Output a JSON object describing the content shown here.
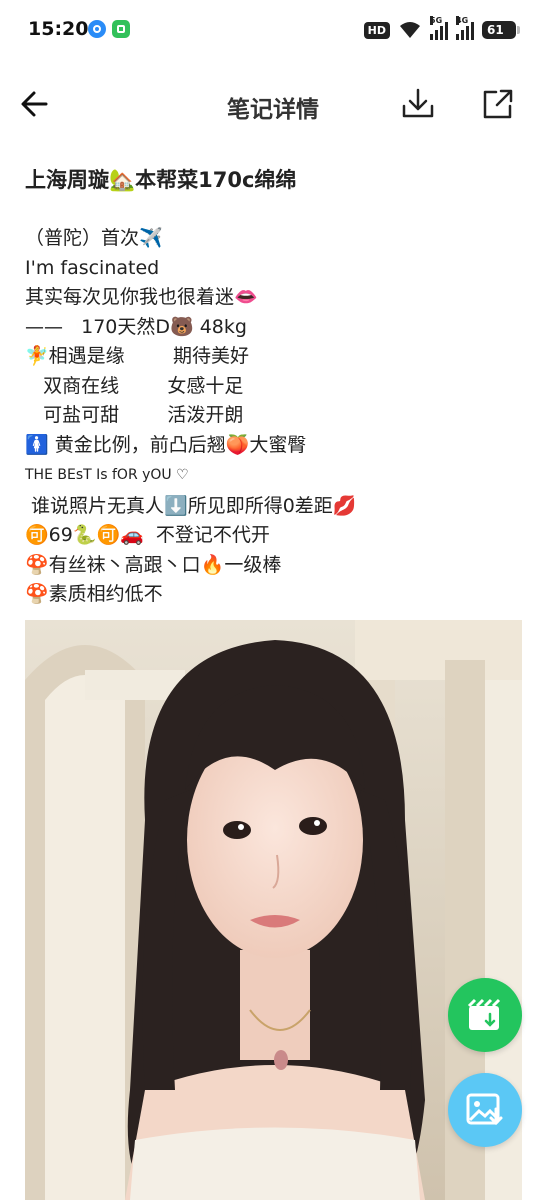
{
  "status_bar": {
    "time": "15:20",
    "hd_label": "HD",
    "net1": "5G",
    "net2": "4G",
    "battery": "61"
  },
  "header": {
    "title": "笔记详情"
  },
  "note": {
    "title": "上海周璇🏡本帮菜170c绵绵",
    "lines": [
      "（普陀）首次✈️",
      "I'm fascinated",
      "其实每次见你我也很着迷👄",
      "——   170天然D🐻 48kg",
      "🧚相遇是缘        期待美好",
      "   双商在线        女感十足",
      "   可盐可甜        活泼开朗",
      "🚺 黄金比例，前凸后翘🍑大蜜臀",
      "THE BEsT Is fOR yOU ♡",
      " 谁说照片无真人⬇️所见即所得0差距💋",
      "🉑69🐍🉑🚗  不登记不代开",
      "🍄有丝袜丶高跟丶口🔥一级棒",
      "🍄素质相约低不"
    ]
  },
  "icons": {
    "back": "arrow-left-icon",
    "download": "download-icon",
    "share": "share-external-icon",
    "video_fab": "video-download-icon",
    "image_fab": "image-download-icon"
  },
  "colors": {
    "video_fab": "#23c55e",
    "image_fab": "#5bc8f5"
  }
}
